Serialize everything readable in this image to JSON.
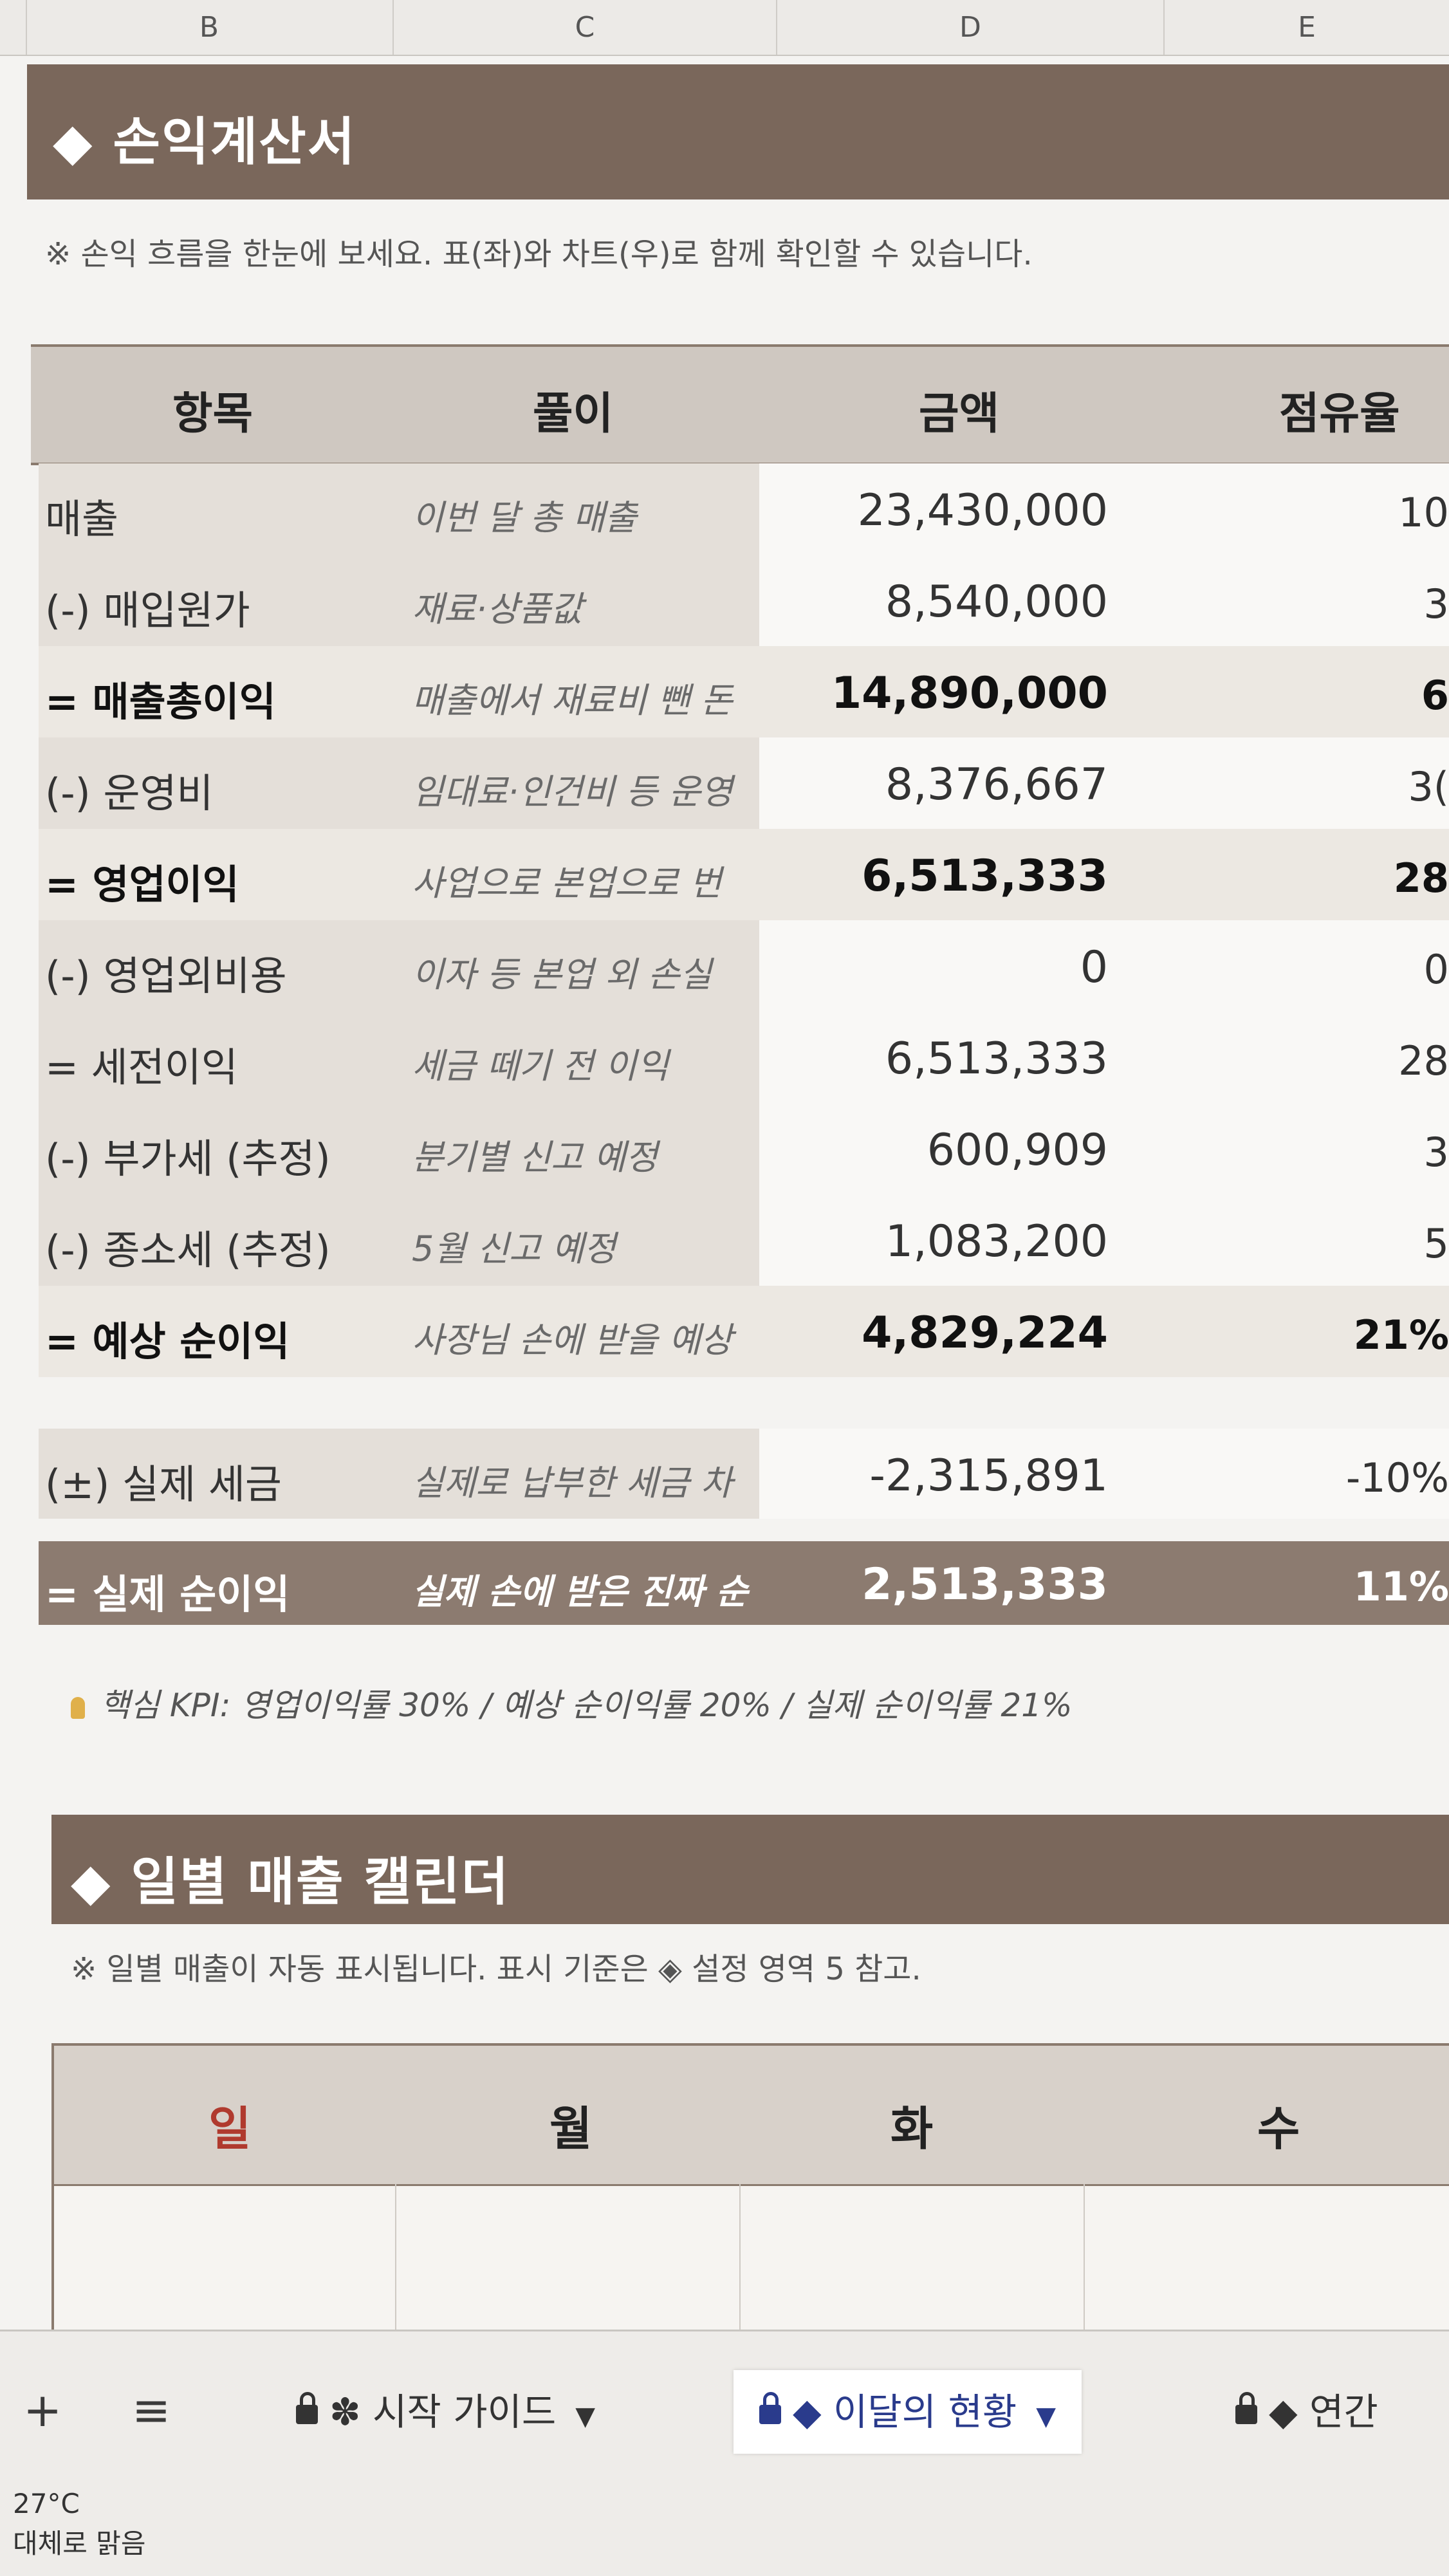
{
  "columns": [
    "B",
    "C",
    "D",
    "E"
  ],
  "section1": {
    "title": "◆ 손익계산서",
    "note": "※ 손익 흐름을 한눈에 보세요. 표(좌)와 차트(우)로 함께 확인할 수 있습니다."
  },
  "table": {
    "headers": [
      "항목",
      "풀이",
      "금액",
      "점유율"
    ],
    "rows": [
      {
        "item": "매출",
        "desc": "이번 달 총 매출",
        "amount": "23,430,000",
        "share": "10"
      },
      {
        "item": "(-) 매입원가",
        "desc": "재료·상품값",
        "amount": "8,540,000",
        "share": "3"
      },
      {
        "item": "= 매출총이익",
        "desc": "매출에서 재료비 뺀 돈",
        "amount": "14,890,000",
        "share": "6"
      },
      {
        "item": "(-) 운영비",
        "desc": "임대료·인건비 등 운영",
        "amount": "8,376,667",
        "share": "3("
      },
      {
        "item": "= 영업이익",
        "desc": "사업으로 본업으로 번",
        "amount": "6,513,333",
        "share": "28"
      },
      {
        "item": "(-) 영업외비용",
        "desc": "이자 등 본업 외 손실",
        "amount": "0",
        "share": "0"
      },
      {
        "item": "= 세전이익",
        "desc": "세금 떼기 전 이익",
        "amount": "6,513,333",
        "share": "28"
      },
      {
        "item": "(-) 부가세 (추정)",
        "desc": "분기별 신고 예정",
        "amount": "600,909",
        "share": "3"
      },
      {
        "item": "(-) 종소세 (추정)",
        "desc": "5월 신고 예정",
        "amount": "1,083,200",
        "share": "5"
      },
      {
        "item": "= 예상 순이익",
        "desc": "사장님 손에 받을 예상",
        "amount": "4,829,224",
        "share": "21%"
      },
      {
        "item": "(±) 실제 세금",
        "desc": "실제로 납부한 세금 차",
        "amount": "-2,315,891",
        "share": "-10%"
      },
      {
        "item": "= 실제 순이익",
        "desc": "실제 손에 받은 진짜 순",
        "amount": "2,513,333",
        "share": "11%"
      }
    ]
  },
  "kpi": "핵심 KPI: 영업이익률 30% / 예상 순이익률 20% / 실제 순이익률 21%",
  "section2": {
    "title": "◆ 일별 매출 캘린더",
    "note": "※ 일별 매출이 자동 표시됩니다. 표시 기준은 ◈ 설정 영역 5 참고."
  },
  "calendar": {
    "days": [
      "일",
      "월",
      "화",
      "수"
    ],
    "sunday_color": "#b03a2e"
  },
  "tabs": {
    "add": "+",
    "menu": "≡",
    "items": [
      "✽ 시작 가이드",
      "◆ 이달의 현황",
      "◆ 연간"
    ]
  },
  "weather": {
    "temp": "27°C",
    "desc": "대체로 맑음"
  },
  "colors": {
    "accent": "#7a675b",
    "tab_blue": "#2a3b8c"
  }
}
